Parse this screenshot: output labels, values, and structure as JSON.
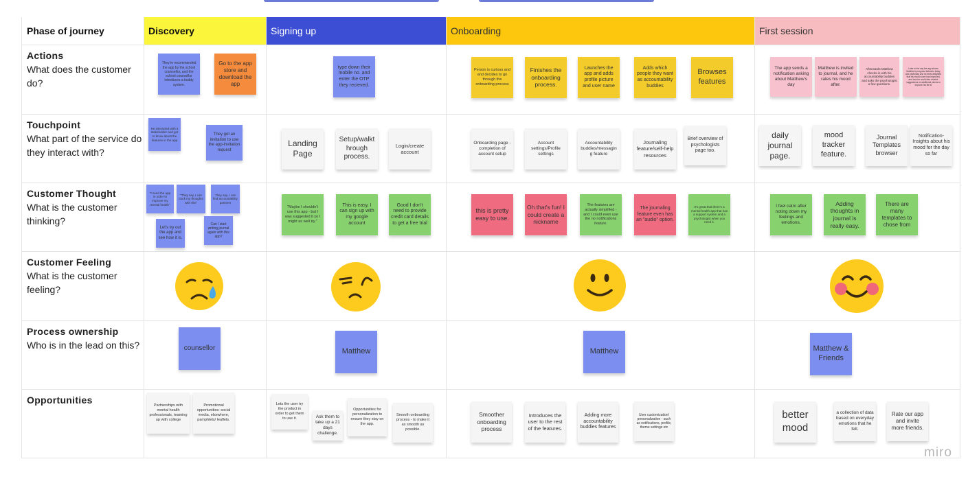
{
  "phase_header_label": "Phase of journey",
  "phases": [
    {
      "name": "Discovery",
      "color": "#fbf53b"
    },
    {
      "name": "Signing up",
      "color": "#3c4fd4"
    },
    {
      "name": "Onboarding",
      "color": "#fdc70d"
    },
    {
      "name": "First session",
      "color": "#f7bcc0"
    }
  ],
  "rows": [
    {
      "title": "Actions",
      "subtitle": "What does the customer do?"
    },
    {
      "title": "Touchpoint",
      "subtitle": "What part of the service do they interact with?"
    },
    {
      "title": "Customer Thought",
      "subtitle": "What is the customer thinking?"
    },
    {
      "title": "Customer Feeling",
      "subtitle": "What is the customer feeling?"
    },
    {
      "title": "Process ownership",
      "subtitle": "Who is in the lead on this?"
    },
    {
      "title": "Opportunities",
      "subtitle": ""
    }
  ],
  "notes": {
    "actions": [
      "They're recommended the app by the school counsellor, and the school counsellor introduces a buddy system.",
      "Go to the app store and download the app",
      "type down their mobile no. and enter the OTP they recieved.",
      "Person is curious and and decides to go through the onboarding process",
      "Finishes the onboarding process.",
      "Launches the app and adds profile picture and user name",
      "Adds which people they want as accountability buddies",
      "Browses features",
      "The app sends a notification asking about Matthew's day",
      "Matthew is invited to journal, and he rates his mood after.",
      "Afterwards Matthew checks-in with his accountability buddies and asks the psychologist a few questions.",
      "Later in the day the app shows Matthew's progress between today and yesterday and he feels delighted that his mood score has improved, and how he could also receive suggestions on additional pieces to improve his life to"
    ],
    "touchpoint": [
      "He interacted with a stakeholder and got to know about the features in the app",
      "They got an invitation to use the app-invitation request",
      "Landing Page",
      "Setup/walkthrough process.",
      "Login/create account",
      "Onboarding page - completion of account setup",
      "Account settings/Profile settings",
      "Accountability buddies/messaging feature",
      "Journaling feature/self-help resources",
      "Brief overview of psychologists page too.",
      "daily journal page.",
      "mood tracker feature.",
      "Journal Templates browser",
      "Notification-Insights about his mood for the day so far"
    ],
    "thought": [
      "\"I need the app in order to improve my mental health\"",
      "\"They say, I can track my thoughts with this\"",
      "They say, I can find accountability partners",
      "Let's try out the app and see how it is.",
      "Can I start writing journal again with this app?",
      "\"Maybe I shouldn't use this app - but I was suggested it so I might as well try.\"",
      "This is easy, I can sign up with my google account",
      "Good I don't need to provide credit card details to get a free trial",
      "this is pretty easy to use.",
      "Oh that's fun! I could create a nickname",
      "The features are actually simplified - and I could even use the no notifications feature.",
      "The journaling feature even has an \"audio\" option.",
      "It's great that there's a mental health app that has a support system and a psychologist when you need it.",
      "I feel calm after noting down my feelings and emotions.",
      "Adding thoughts in journal is really easy.",
      "There are many templates to chose from"
    ],
    "ownership": [
      "counsellor",
      "Matthew",
      "Matthew",
      "Matthew & Friends"
    ],
    "opportunities": [
      "Partnerships with mental health professionals, teaming up with college",
      "Promotional opportunities: social media, elsewhere, pamphlets/ leaflets.",
      "Lets the user try the product in order to get them to use it.",
      "Ask them to take up a 21 days challenge.",
      "Opportunities for personalization to ensure they stay on the app.",
      "Smooth onboarding process - to make it as smooth as possible.",
      "Smoother onboarding process",
      "Introduces the user to the rest of the features.",
      "Adding more accountability buddies features",
      "User customization/ personalization - such as notifications, profile, theme settings etc",
      "better mood",
      "a collection of data based on everyday emotions that he felt.",
      "Rate our app and invite more friends."
    ]
  },
  "feelings": [
    "sad-tear-face-icon",
    "unamused-face-icon",
    "smiling-face-icon",
    "blushing-face-icon"
  ],
  "logo": "miro"
}
